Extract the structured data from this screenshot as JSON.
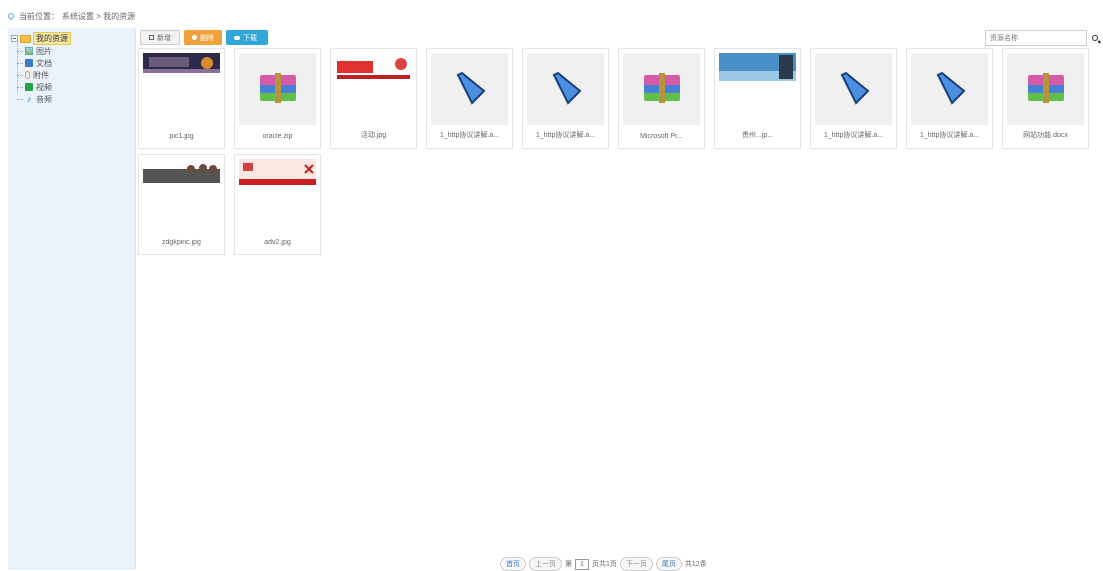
{
  "breadcrumb": {
    "label": "当前位置：",
    "path": "系统设置 > 我的资源"
  },
  "sidebar": {
    "root": "我的资源",
    "items": [
      {
        "label": "图片",
        "icon": "image-icon"
      },
      {
        "label": "文档",
        "icon": "document-icon"
      },
      {
        "label": "附件",
        "icon": "attachment-icon"
      },
      {
        "label": "视频",
        "icon": "video-icon"
      },
      {
        "label": "音频",
        "icon": "audio-icon"
      }
    ]
  },
  "toolbar": {
    "new_label": "新增",
    "delete_label": "删除",
    "download_label": "下载"
  },
  "search": {
    "placeholder": "资源名称"
  },
  "files": [
    {
      "name": "pic1.jpg",
      "type": "photo-dark"
    },
    {
      "name": "oracle.zip",
      "type": "archive"
    },
    {
      "name": "活动.jpg",
      "type": "photo-red"
    },
    {
      "name": "1_http协议讲解.a...",
      "type": "video"
    },
    {
      "name": "1_http协议讲解.a...",
      "type": "video"
    },
    {
      "name": "Microsoft Pr...",
      "type": "archive"
    },
    {
      "name": "贵州...jp...",
      "type": "photo-blue"
    },
    {
      "name": "1_http协议讲解.a...",
      "type": "video"
    },
    {
      "name": "1_http协议讲解.a...",
      "type": "video"
    },
    {
      "name": "网站功能.docx",
      "type": "archive"
    },
    {
      "name": "zdgkpinc.jpg",
      "type": "photo-banner"
    },
    {
      "name": "adv2.jpg",
      "type": "photo-red2"
    }
  ],
  "pager": {
    "first": "首页",
    "prev": "上一页",
    "page_prefix": "第",
    "page": "1",
    "page_suffix": "页共1页",
    "next": "下一页",
    "last": "尾页",
    "total": "共12条"
  }
}
